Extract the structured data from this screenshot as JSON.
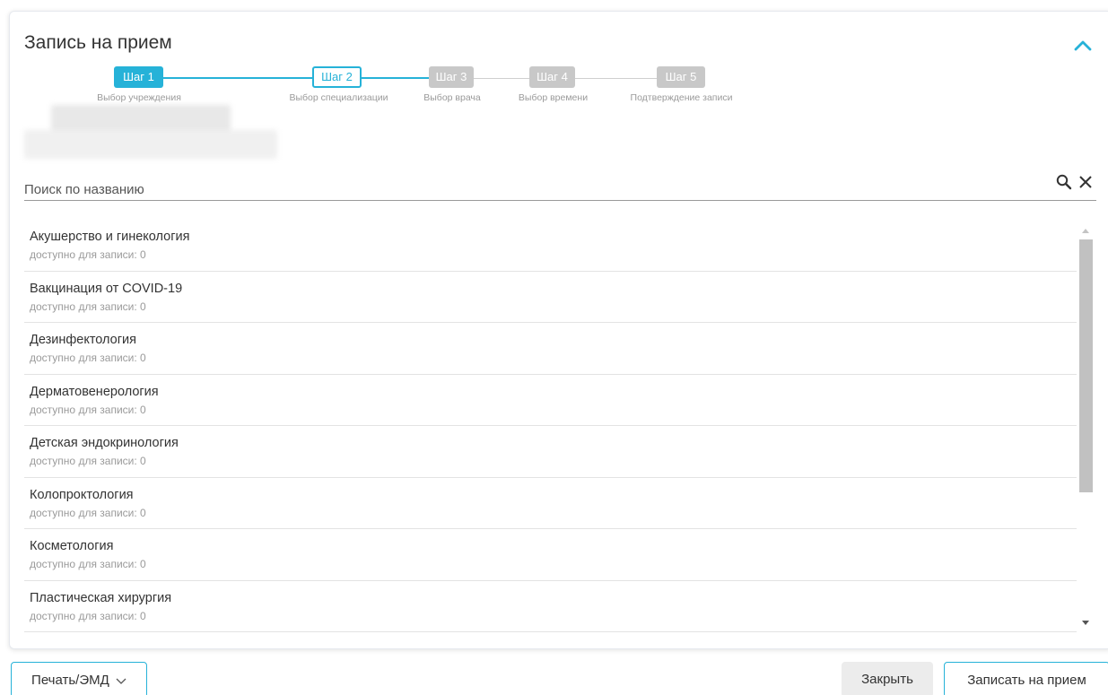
{
  "header": {
    "title": "Запись на прием"
  },
  "stepper": {
    "steps": [
      {
        "label": "Шаг 1",
        "caption": "Выбор учреждения",
        "state": "done"
      },
      {
        "label": "Шаг 2",
        "caption": "Выбор специализации",
        "state": "current"
      },
      {
        "label": "Шаг 3",
        "caption": "Выбор врача",
        "state": "inactive"
      },
      {
        "label": "Шаг 4",
        "caption": "Выбор времени",
        "state": "inactive"
      },
      {
        "label": "Шаг 5",
        "caption": "Подтверждение записи",
        "state": "inactive"
      }
    ]
  },
  "search": {
    "placeholder": "Поиск по названию",
    "value": ""
  },
  "list": {
    "items": [
      {
        "name": "Акушерство и гинекология",
        "available": "доступно для записи: 0"
      },
      {
        "name": "Вакцинация от COVID-19",
        "available": "доступно для записи: 0"
      },
      {
        "name": "Дезинфектология",
        "available": "доступно для записи: 0"
      },
      {
        "name": "Дерматовенерология",
        "available": "доступно для записи: 0"
      },
      {
        "name": "Детская эндокринология",
        "available": "доступно для записи: 0"
      },
      {
        "name": "Колопроктология",
        "available": "доступно для записи: 0"
      },
      {
        "name": "Косметология",
        "available": "доступно для записи: 0"
      },
      {
        "name": "Пластическая хирургия",
        "available": "доступно для записи: 0"
      }
    ]
  },
  "footer": {
    "print_label": "Печать/ЭМД",
    "close_label": "Закрыть",
    "submit_label": "Записать на прием"
  },
  "colors": {
    "accent": "#26b2d8",
    "inactive_step": "#c8c8c8",
    "close_bg": "#ececec"
  },
  "icons": [
    "chevron-up-icon",
    "search-icon",
    "close-icon",
    "chevron-down-icon"
  ]
}
